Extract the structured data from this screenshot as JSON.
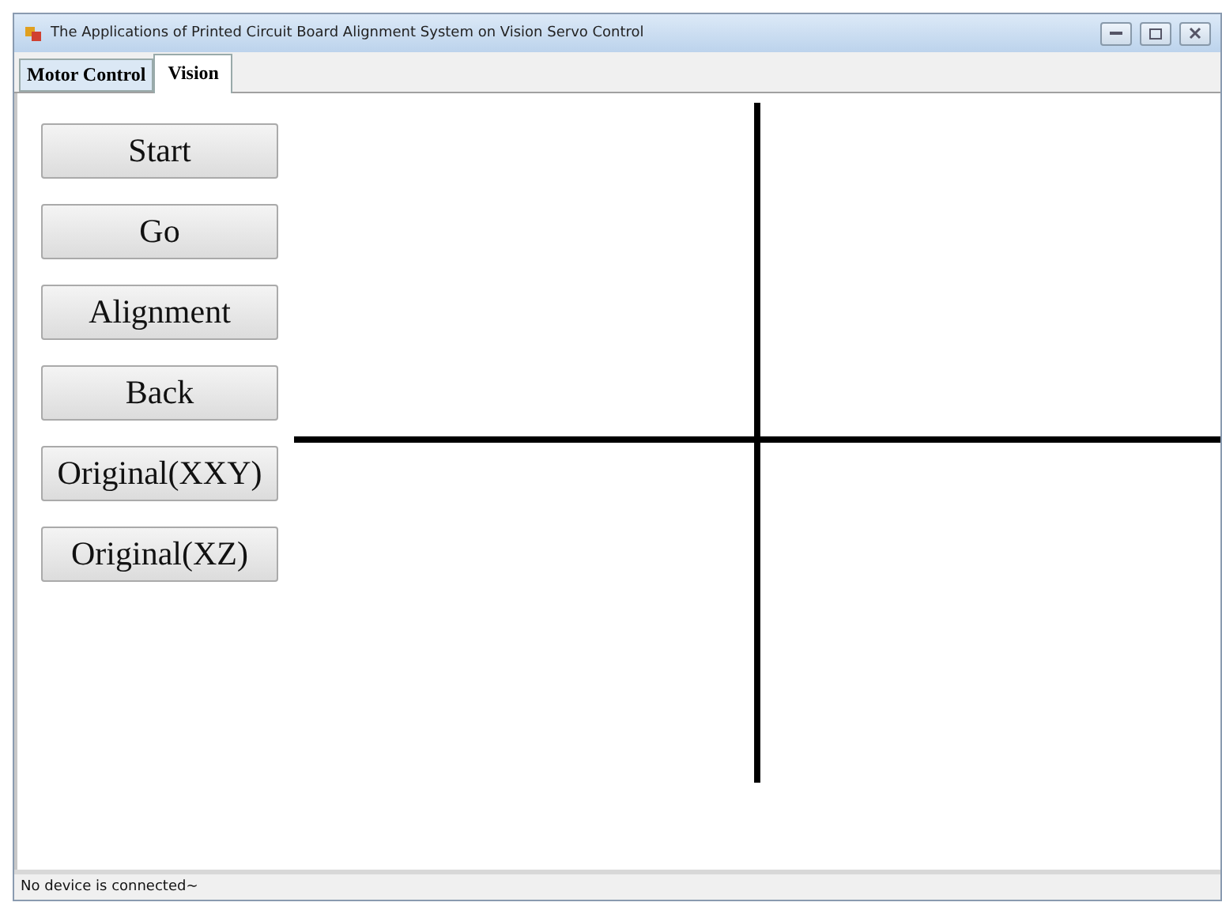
{
  "window": {
    "title": "The Applications of Printed Circuit Board Alignment System on Vision Servo Control"
  },
  "tabs": [
    {
      "label": "Motor Control",
      "selected": false
    },
    {
      "label": "Vision",
      "selected": true
    }
  ],
  "buttons": [
    "Start",
    "Go",
    "Alignment",
    "Back",
    "Original(XXY)",
    "Original(XZ)"
  ],
  "status_bar": {
    "text": "No device is connected~"
  }
}
